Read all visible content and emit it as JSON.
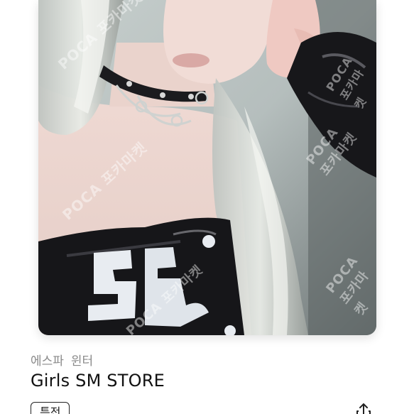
{
  "item": {
    "group": "에스파",
    "member": "윈터",
    "title": "Girls SM STORE",
    "tag": "특전"
  },
  "watermark": {
    "text": "POCA 포카마켓"
  },
  "icons": {
    "share": "share-icon"
  },
  "colors": {
    "meta_text": "#8a8a8a",
    "title_text": "#111111",
    "tag_border": "#222222"
  }
}
